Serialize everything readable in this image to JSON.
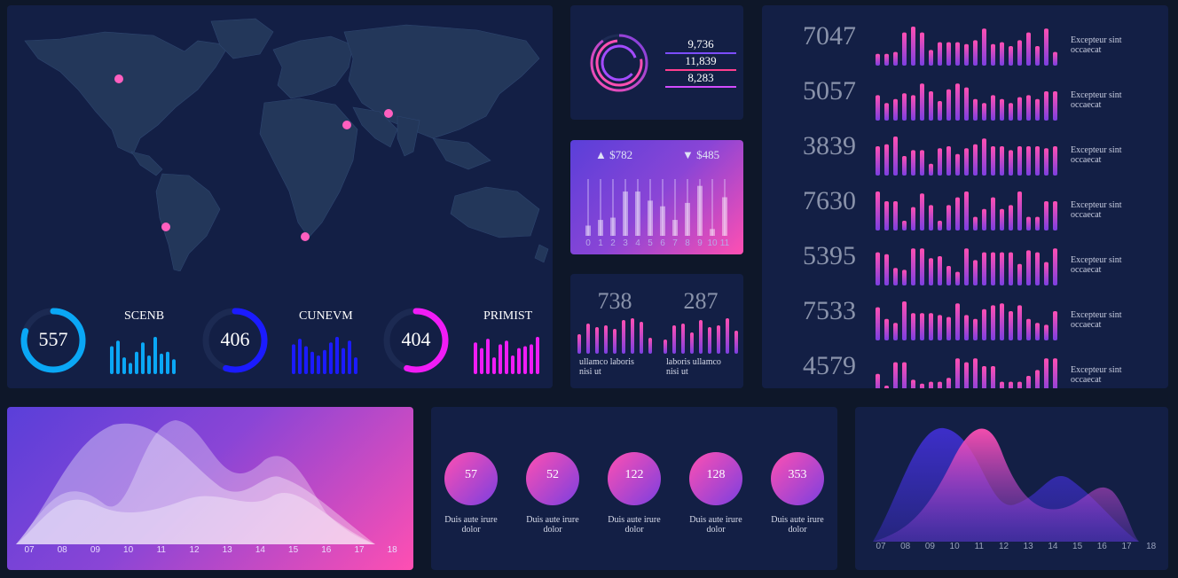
{
  "map_panel": {
    "gauges": [
      {
        "value": "557",
        "title": "SCENB",
        "color": "#0aa7f5",
        "fraction": 0.8,
        "bars": [
          0.75,
          0.9,
          0.45,
          0.3,
          0.6,
          0.85,
          0.5,
          1.0,
          0.55,
          0.6,
          0.4
        ]
      },
      {
        "value": "406",
        "title": "CUNEVM",
        "color": "#1b1bff",
        "fraction": 0.55,
        "bars": [
          0.8,
          0.95,
          0.75,
          0.6,
          0.5,
          0.65,
          0.85,
          1.0,
          0.7,
          0.9,
          0.45
        ]
      },
      {
        "value": "404",
        "title": "PRIMIST",
        "color": "#f01cf5",
        "fraction": 0.55,
        "bars": [
          0.85,
          0.7,
          0.95,
          0.45,
          0.8,
          0.9,
          0.5,
          0.7,
          0.75,
          0.8,
          1.0
        ]
      }
    ]
  },
  "ring_panel": {
    "values": [
      "9,736",
      "11,839",
      "8,283"
    ],
    "line_colors": [
      "#7c4dff",
      "#ff3f8f",
      "#d24bff"
    ]
  },
  "candle_panel": {
    "up_label": "▲ $782",
    "down_label": "▼ $485",
    "x_labels": [
      "0",
      "1",
      "2",
      "3",
      "4",
      "5",
      "6",
      "7",
      "8",
      "9",
      "10",
      "11"
    ],
    "values": [
      0.18,
      0.28,
      0.32,
      0.78,
      0.78,
      0.62,
      0.52,
      0.28,
      0.58,
      0.88,
      0.12,
      0.68
    ]
  },
  "dual_panel": {
    "left": {
      "value": "738",
      "caption": "ullamco laboris nisi ut",
      "bars": [
        0.55,
        0.85,
        0.75,
        0.8,
        0.7,
        0.95,
        1.0,
        0.9,
        0.45
      ]
    },
    "right": {
      "value": "287",
      "caption": "laboris ullamco nisi ut",
      "bars": [
        0.4,
        0.8,
        0.85,
        0.6,
        0.95,
        0.75,
        0.8,
        1.0,
        0.65
      ]
    }
  },
  "stats_panel": {
    "rows": [
      {
        "value": "7047",
        "caption": "Excepteur sint occaecat",
        "bars": [
          0.3,
          0.3,
          0.35,
          0.85,
          1.0,
          0.85,
          0.4,
          0.6,
          0.6,
          0.6,
          0.55,
          0.65,
          0.95,
          0.55,
          0.6,
          0.5,
          0.65,
          0.85,
          0.5,
          0.95,
          0.35
        ]
      },
      {
        "value": "5057",
        "caption": "Excepteur sint occaecat",
        "bars": [
          0.65,
          0.45,
          0.55,
          0.7,
          0.65,
          0.95,
          0.75,
          0.5,
          0.8,
          0.95,
          0.85,
          0.55,
          0.45,
          0.65,
          0.55,
          0.45,
          0.6,
          0.65,
          0.55,
          0.75,
          0.75
        ]
      },
      {
        "value": "3839",
        "caption": "Excepteur sint occaecat",
        "bars": [
          0.75,
          0.8,
          1.0,
          0.5,
          0.65,
          0.65,
          0.3,
          0.7,
          0.75,
          0.55,
          0.7,
          0.8,
          0.95,
          0.75,
          0.75,
          0.65,
          0.75,
          0.75,
          0.75,
          0.7,
          0.75
        ]
      },
      {
        "value": "7630",
        "caption": "Excepteur sint occaecat",
        "bars": [
          1.0,
          0.75,
          0.75,
          0.25,
          0.6,
          0.95,
          0.65,
          0.25,
          0.65,
          0.85,
          1.0,
          0.35,
          0.55,
          0.85,
          0.55,
          0.65,
          1.0,
          0.35,
          0.35,
          0.75,
          0.75
        ]
      },
      {
        "value": "5395",
        "caption": "Excepteur sint occaecat",
        "bars": [
          0.85,
          0.8,
          0.45,
          0.4,
          0.95,
          0.95,
          0.7,
          0.75,
          0.5,
          0.35,
          0.95,
          0.65,
          0.85,
          0.85,
          0.85,
          0.85,
          0.55,
          0.9,
          0.85,
          0.6,
          0.95
        ]
      },
      {
        "value": "7533",
        "caption": "Excepteur sint occaecat",
        "bars": [
          0.85,
          0.55,
          0.45,
          1.0,
          0.7,
          0.7,
          0.7,
          0.65,
          0.6,
          0.95,
          0.65,
          0.55,
          0.8,
          0.9,
          0.95,
          0.75,
          0.9,
          0.55,
          0.45,
          0.4,
          0.75
        ]
      },
      {
        "value": "4579",
        "caption": "Excepteur sint occaecat",
        "bars": [
          0.55,
          0.25,
          0.85,
          0.85,
          0.4,
          0.3,
          0.35,
          0.35,
          0.45,
          0.95,
          0.85,
          0.95,
          0.75,
          0.75,
          0.35,
          0.35,
          0.35,
          0.5,
          0.65,
          0.95,
          0.95
        ]
      }
    ]
  },
  "area_panel_left": {
    "x_labels": [
      "07",
      "08",
      "09",
      "10",
      "11",
      "12",
      "13",
      "14",
      "15",
      "16",
      "17",
      "18"
    ]
  },
  "bubbles_panel": {
    "items": [
      {
        "value": "57",
        "caption": "Duis aute irure dolor"
      },
      {
        "value": "52",
        "caption": "Duis aute irure dolor"
      },
      {
        "value": "122",
        "caption": "Duis aute irure dolor"
      },
      {
        "value": "128",
        "caption": "Duis aute irure dolor"
      },
      {
        "value": "353",
        "caption": "Duis aute irure dolor"
      }
    ]
  },
  "area_panel_right": {
    "x_labels": [
      "07",
      "08",
      "09",
      "10",
      "11",
      "12",
      "13",
      "14",
      "15",
      "16",
      "17",
      "18"
    ]
  }
}
